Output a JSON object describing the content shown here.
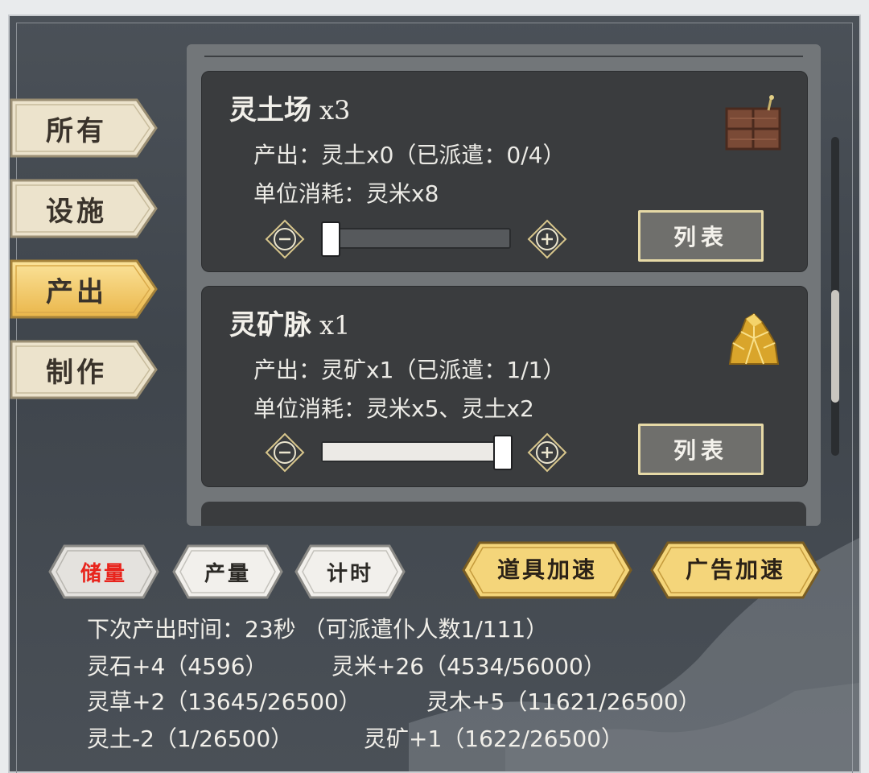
{
  "colors": {
    "tab_active": "#f2c65a",
    "tab_inactive": "#ece3cc",
    "storage_label": "#e8241c",
    "gold_button": "#f4d57a"
  },
  "tabs": [
    {
      "label": "所有",
      "active": false
    },
    {
      "label": "设施",
      "active": false
    },
    {
      "label": "产出",
      "active": true
    },
    {
      "label": "制作",
      "active": false
    }
  ],
  "cards": [
    {
      "name": "灵土场",
      "count": "x3",
      "output": "产出：灵土x0（已派遣：0/4）",
      "consume": "单位消耗：灵米x8",
      "slider_value": 0.0,
      "icon": "soil-field-icon",
      "list_label": "列表"
    },
    {
      "name": "灵矿脉",
      "count": "x1",
      "output": "产出：灵矿x1（已派遣：1/1）",
      "consume": "单位消耗：灵米x5、灵土x2",
      "slider_value": 1.0,
      "icon": "ore-vein-icon",
      "list_label": "列表"
    }
  ],
  "bottom_buttons": {
    "storage": "储量",
    "production": "产量",
    "timer": "计时",
    "item_speedup": "道具加速",
    "ad_speedup": "广告加速"
  },
  "info": {
    "next_output": "下次产出时间：23秒 （可派遣仆人数1/111）",
    "stone": "灵石+4（4596）",
    "rice": "灵米+26（4534/56000）",
    "herb": "灵草+2（13645/26500）",
    "wood": "灵木+5（11621/26500）",
    "soil": "灵土-2（1/26500）",
    "ore": "灵矿+1（1622/26500）"
  }
}
